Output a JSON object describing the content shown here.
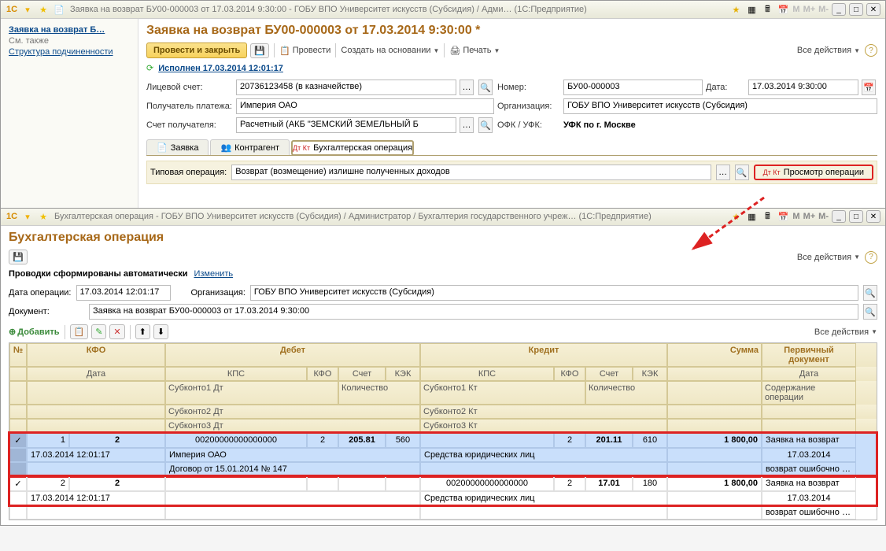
{
  "win1": {
    "title": "Заявка на возврат БУ00-000003 от 17.03.2014 9:30:00 - ГОБУ ВПО Университет искусств (Субсидия) / Адми…   (1С:Предприятие)",
    "sidebar": {
      "main_link": "Заявка на возврат Б…",
      "also": "См. также",
      "subord": "Структура подчиненности"
    },
    "header": "Заявка на возврат БУ00-000003 от 17.03.2014 9:30:00 *",
    "toolbar": {
      "post_close": "Провести и закрыть",
      "post": "Провести",
      "create_based": "Создать на основании",
      "print": "Печать",
      "all_actions": "Все действия"
    },
    "executed": "Исполнен 17.03.2014 12:01:17",
    "fields": {
      "acct_lbl": "Лицевой счет:",
      "acct_val": "20736123458 (в казначействе)",
      "num_lbl": "Номер:",
      "num_val": "БУ00-000003",
      "date_lbl": "Дата:",
      "date_val": "17.03.2014  9:30:00",
      "payee_lbl": "Получатель платежа:",
      "payee_val": "Империя ОАО",
      "org_lbl": "Организация:",
      "org_val": "ГОБУ ВПО Университет искусств (Субсидия)",
      "rcpt_acct_lbl": "Счет получателя:",
      "rcpt_acct_val": "Расчетный (АКБ \"ЗЕМСКИЙ ЗЕМЕЛЬНЫЙ Б",
      "ofk_lbl": "ОФК / УФК:",
      "ofk_val": "УФК по г. Москве"
    },
    "tabs": {
      "t1": "Заявка",
      "t2": "Контрагент",
      "t3": "Бухгалтерская операция"
    },
    "typ": {
      "lbl": "Типовая операция:",
      "val": "Возврат (возмещение) излишне полученных доходов",
      "view": "Просмотр операции"
    }
  },
  "win2": {
    "title": "Бухгалтерская операция - ГОБУ ВПО Университет искусств (Субсидия) / Администратор / Бухгалтерия государственного учреж…  (1С:Предприятие)",
    "header": "Бухгалтерская операция",
    "all_actions": "Все действия",
    "auto": {
      "text": "Проводки сформированы автоматически",
      "change": "Изменить"
    },
    "f": {
      "opdate_lbl": "Дата операции:",
      "opdate_val": "17.03.2014 12:01:17",
      "org_lbl": "Организация:",
      "org_val": "ГОБУ ВПО Университет искусств (Субсидия)",
      "doc_lbl": "Документ:",
      "doc_val": "Заявка на возврат БУ00-000003 от 17.03.2014 9:30:00"
    },
    "tb": {
      "add": "Добавить"
    },
    "grid": {
      "h": {
        "num": "№",
        "kfo": "КФО",
        "date": "Дата",
        "debit": "Дебет",
        "credit": "Кредит",
        "kps": "КПС",
        "kfo2": "КФО",
        "acct": "Счет",
        "kek": "КЭК",
        "qty": "Количество",
        "sum": "Сумма",
        "primdoc": "Первичный документ",
        "s1d": "Субконто1 Дт",
        "s2d": "Субконто2 Дт",
        "s3d": "Субконто3 Дт",
        "s1k": "Субконто1 Кт",
        "s2k": "Субконто2 Кт",
        "s3k": "Субконто3 Кт",
        "pdate": "Дата",
        "content": "Содержание операции"
      },
      "r1": {
        "n": "1",
        "kfo": "2",
        "date": "17.03.2014 12:01:17",
        "dkps": "00200000000000000",
        "dkfo": "2",
        "dacct": "205.81",
        "dkek": "560",
        "ckps": "",
        "ckfo": "2",
        "cacct": "201.11",
        "ckek": "610",
        "sum": "1 800,00",
        "prim": "Заявка на возврат",
        "s1d": "Империя ОАО",
        "s2d": "Договор от 15.01.2014 № 147",
        "s1k": "Средства юридических лиц",
        "pdate": "17.03.2014",
        "content": "возврат ошибочно пер средств"
      },
      "r2": {
        "n": "2",
        "kfo": "2",
        "date": "17.03.2014 12:01:17",
        "ckps": "00200000000000000",
        "ckfo": "2",
        "cacct": "17.01",
        "ckek": "180",
        "sum": "1 800,00",
        "prim": "Заявка на возврат",
        "s1k": "Средства юридических лиц",
        "pdate": "17.03.2014",
        "content": "возврат ошибочно пер средств"
      }
    }
  }
}
